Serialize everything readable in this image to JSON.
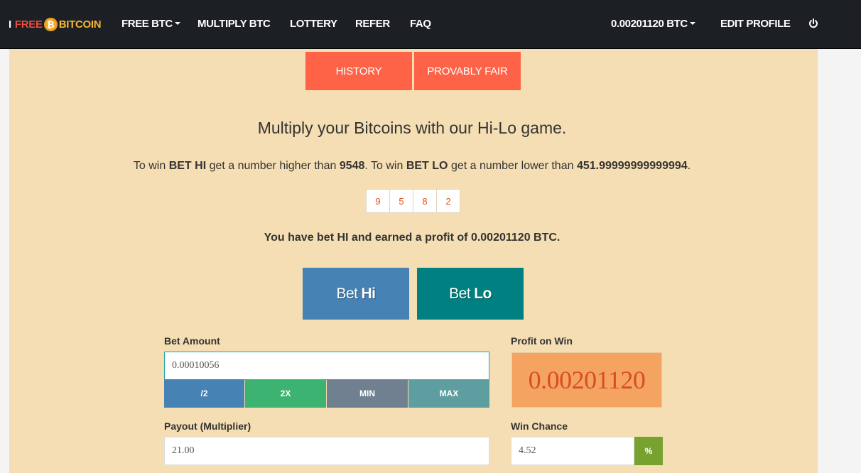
{
  "brand": {
    "i": "I",
    "free": "FREE",
    "coin_symbol": "₿",
    "bitcoin": "BITCOIN"
  },
  "nav": {
    "free_btc": "FREE BTC",
    "multiply_btc": "MULTIPLY BTC",
    "lottery": "LOTTERY",
    "refer": "REFER",
    "faq": "FAQ",
    "balance": "0.00201120 BTC",
    "edit_profile": "EDIT PROFILE",
    "power_icon": "power-icon"
  },
  "tabs": {
    "history": "HISTORY",
    "provably_fair": "PROVABLY FAIR"
  },
  "game": {
    "headline": "Multiply your Bitcoins with our Hi-Lo game.",
    "rule_prefix": "To win ",
    "bet_hi_label": "BET HI",
    "rule_hi_mid": " get a number higher than ",
    "hi_threshold": "9548",
    "rule_mid2": ". To win ",
    "bet_lo_label": "BET LO",
    "rule_lo_mid": " get a number lower than ",
    "lo_threshold": "451.99999999999994",
    "rule_end": ".",
    "rolled_digits": [
      "9",
      "5",
      "8",
      "2"
    ],
    "result": "You have bet HI and earned a profit of 0.00201120 BTC."
  },
  "buttons": {
    "bet_hi_prefix": "Bet",
    "bet_hi_strong": "Hi",
    "bet_lo_prefix": "Bet",
    "bet_lo_strong": "Lo",
    "half": "/2",
    "double": "2X",
    "min": "MIN",
    "max": "MAX",
    "percent": "%"
  },
  "form": {
    "bet_amount_label": "Bet Amount",
    "bet_amount_value": "0.00010056",
    "profit_label": "Profit on Win",
    "profit_value": "0.00201120",
    "payout_label": "Payout (Multiplier)",
    "payout_value": "21.00",
    "win_chance_label": "Win Chance",
    "win_chance_value": "4.52"
  },
  "colors": {
    "navbar": "#1c1f24",
    "panel": "#f5deb3",
    "tab": "#ff6347",
    "bet_hi": "#4682b4",
    "bet_lo": "#008080",
    "half": "#4682b4",
    "double": "#3cb371",
    "min": "#708090",
    "max": "#5f9ea0",
    "profit_box": "#f4a460",
    "percent": "#78a22f"
  }
}
